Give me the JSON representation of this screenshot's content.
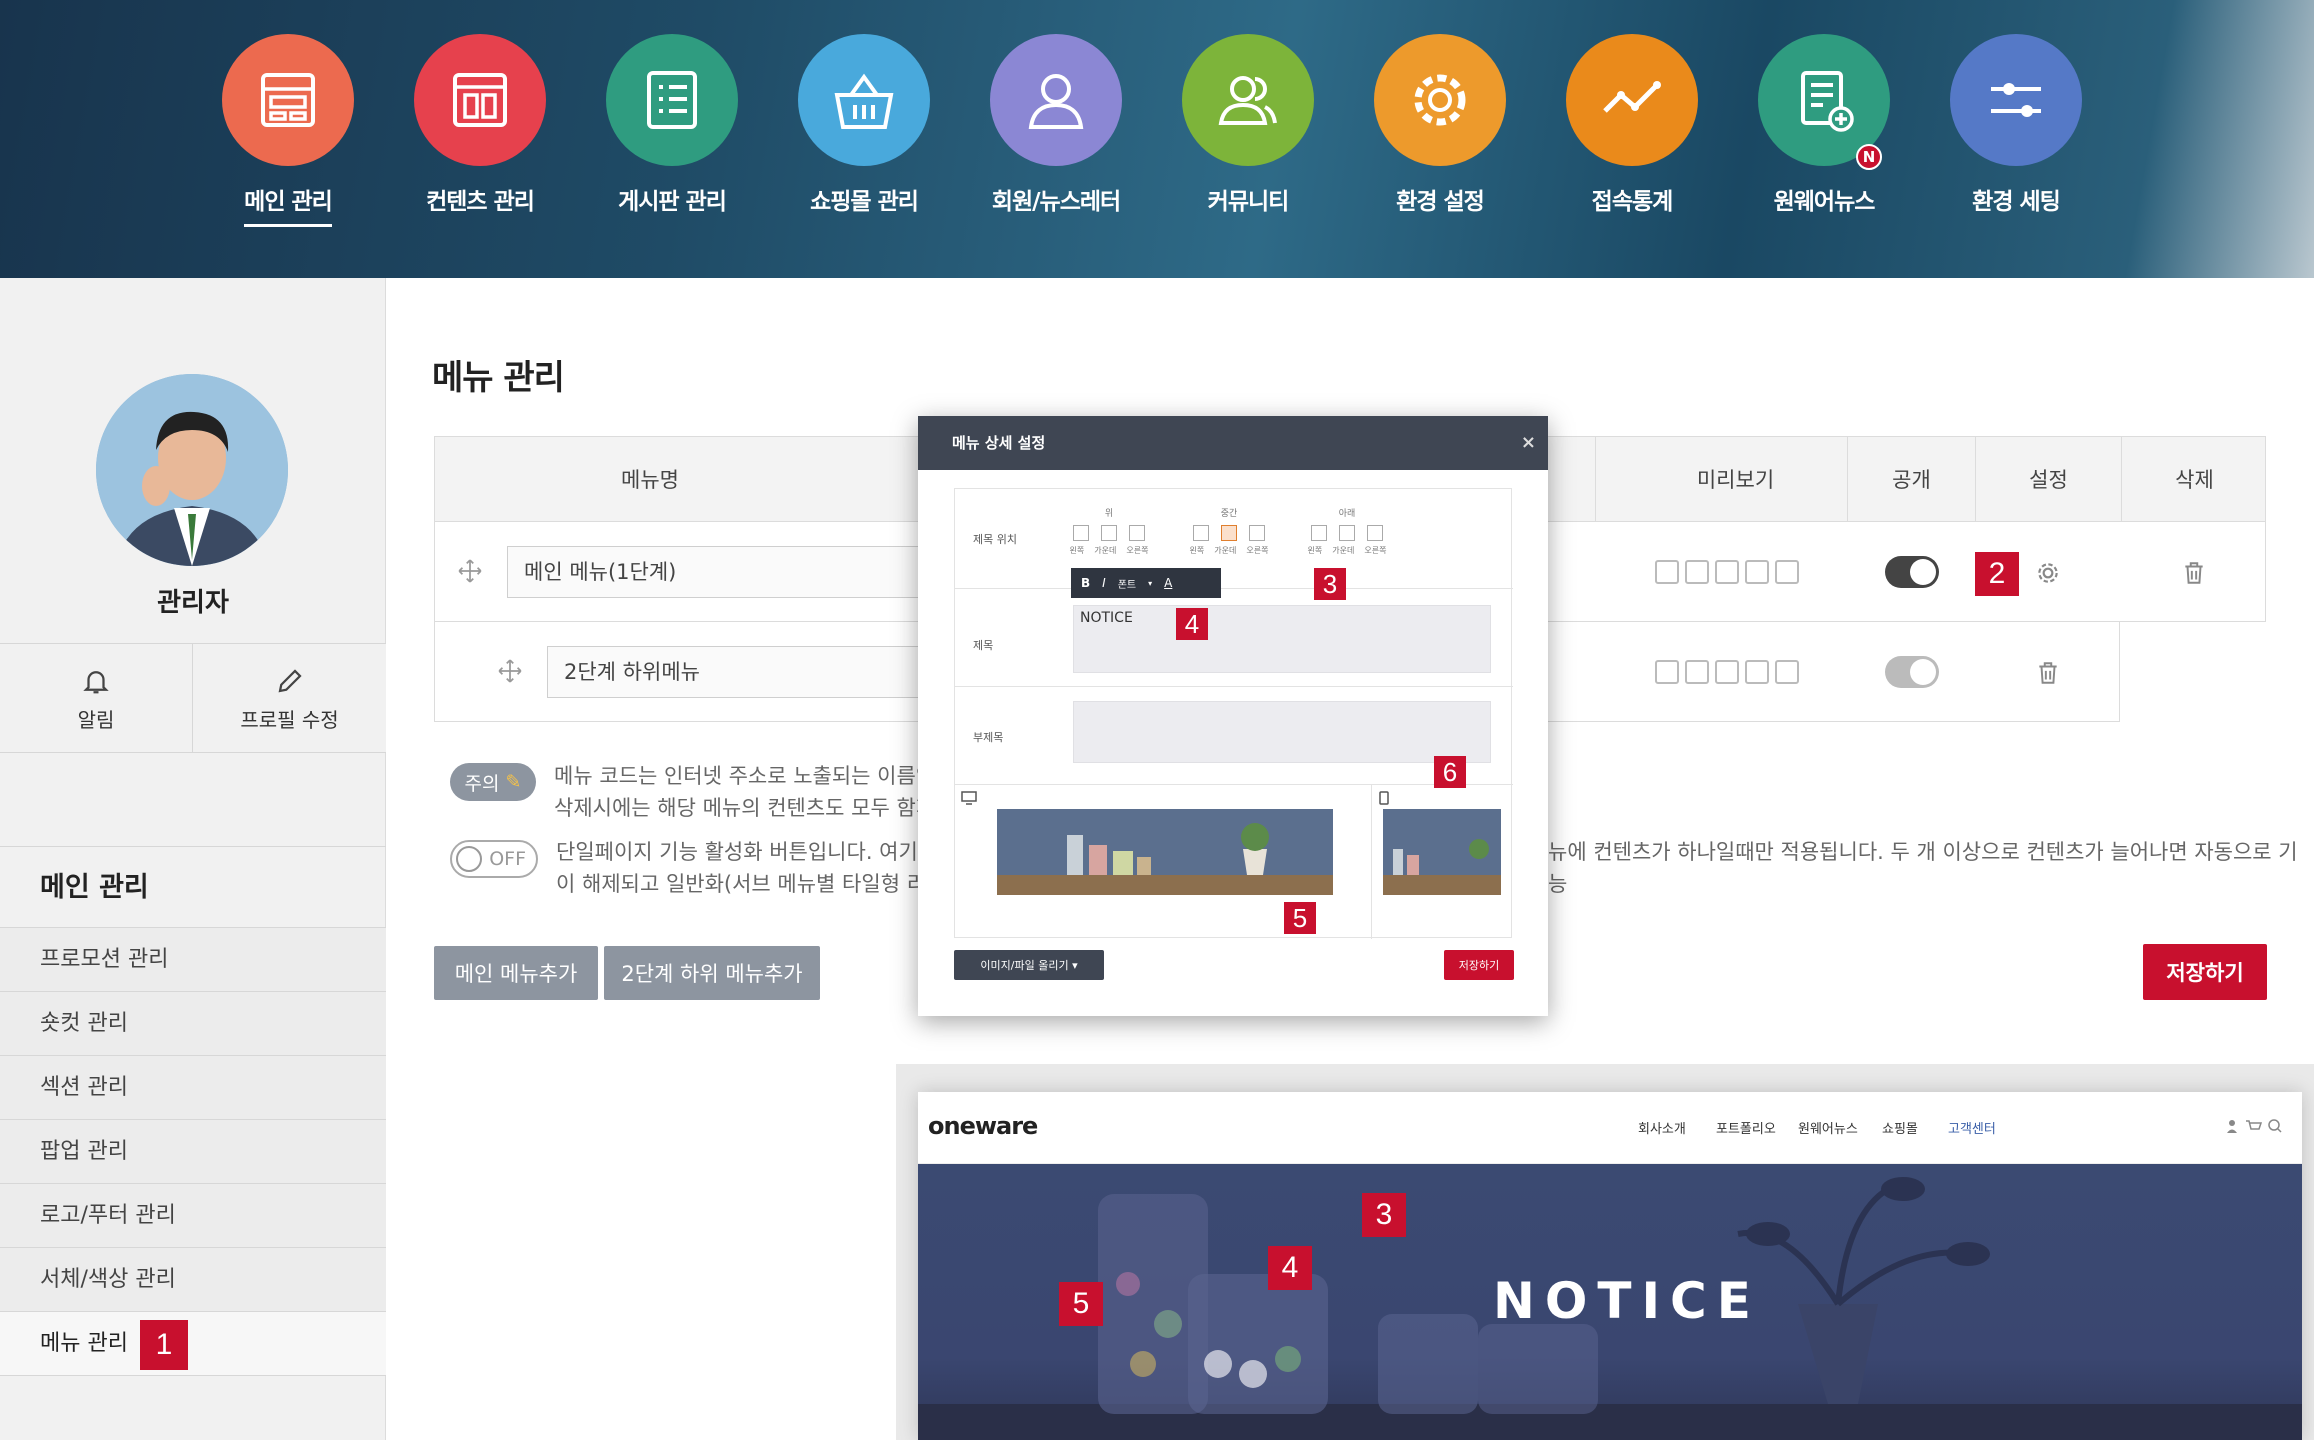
{
  "top_nav": [
    {
      "label": "메인 관리",
      "icon": "layout-icon",
      "color": "#ec6a4f",
      "active": true
    },
    {
      "label": "컨텐츠 관리",
      "icon": "content-icon",
      "color": "#e6414d"
    },
    {
      "label": "게시판 관리",
      "icon": "list-icon",
      "color": "#2f9c80"
    },
    {
      "label": "쇼핑몰 관리",
      "icon": "basket-icon",
      "color": "#49a9dc"
    },
    {
      "label": "회원/뉴스레터",
      "icon": "user-icon",
      "color": "#8b87d4"
    },
    {
      "label": "커뮤니티",
      "icon": "users-icon",
      "color": "#7db43a"
    },
    {
      "label": "환경 설정",
      "icon": "gear-icon",
      "color": "#ed9a2c"
    },
    {
      "label": "접속통계",
      "icon": "stats-icon",
      "color": "#ea8a1b"
    },
    {
      "label": "원웨어뉴스",
      "icon": "news-icon",
      "color": "#2f9c80",
      "badge": "N"
    },
    {
      "label": "환경 세팅",
      "icon": "sliders-icon",
      "color": "#5579c7"
    }
  ],
  "sidebar": {
    "admin_name": "관리자",
    "buttons": {
      "alert": "알림",
      "profile": "프로필 수정"
    },
    "section_title": "메인 관리",
    "items": [
      "프로모션 관리",
      "숏컷 관리",
      "섹션 관리",
      "팝업 관리",
      "로고/푸터 관리",
      "서체/색상 관리",
      "메뉴 관리"
    ],
    "active_index": 6,
    "marker": "1"
  },
  "main": {
    "title": "메뉴 관리",
    "table": {
      "headers": {
        "name": "메뉴명",
        "preview": "미리보기",
        "public": "공개",
        "settings": "설정",
        "delete": "삭제"
      },
      "rows": [
        {
          "name": "메인 메뉴(1단계)",
          "public": true
        },
        {
          "name": "2단계 하위메뉴",
          "public": false
        }
      ],
      "marker": "2"
    },
    "notice_badge": "주의",
    "notice_line1": "메뉴 코드는 인터넷 주소로 노출되는 이름입니",
    "notice_line2": "삭제시에는 해당 메뉴의 컨텐츠도 모두 함께 삭",
    "toggle_off": "OFF",
    "single_line1_left": "단일페이지 기능 활성화 버튼입니다. 여기를 ",
    "single_line1_right": "뉴에 컨텐츠가 하나일때만 적용됩니다. 두 개 이상으로 컨텐츠가 늘어나면 자동으로 기능",
    "single_line2": "이 해제되고 일반화(서브 메뉴별 타일형 리스트",
    "add_main": "메인 메뉴추가",
    "add_sub": "2단계 하위 메뉴추가",
    "save": "저장하기"
  },
  "modal": {
    "title": "메뉴 상세 설정",
    "close": "×",
    "pos_label": "제목 위치",
    "groups": [
      "위",
      "중간",
      "아래"
    ],
    "aligns": [
      "왼쪽",
      "가운데",
      "오른쪽"
    ],
    "toolbar": {
      "bold": "B",
      "italic": "I",
      "font": "폰트",
      "color": "A"
    },
    "title_label": "제목",
    "title_value": "NOTICE",
    "subtitle_label": "부제목",
    "upload": "이미지/파일 올리기 ▾",
    "save": "저장하기",
    "markers": [
      "3",
      "4",
      "5",
      "6"
    ]
  },
  "preview": {
    "logo": "oneware",
    "nav": [
      "회사소개",
      "포트폴리오",
      "원웨어뉴스",
      "쇼핑몰",
      "고객센터"
    ],
    "hero_text": "NOTICE",
    "markers": [
      "3",
      "4",
      "5"
    ]
  }
}
